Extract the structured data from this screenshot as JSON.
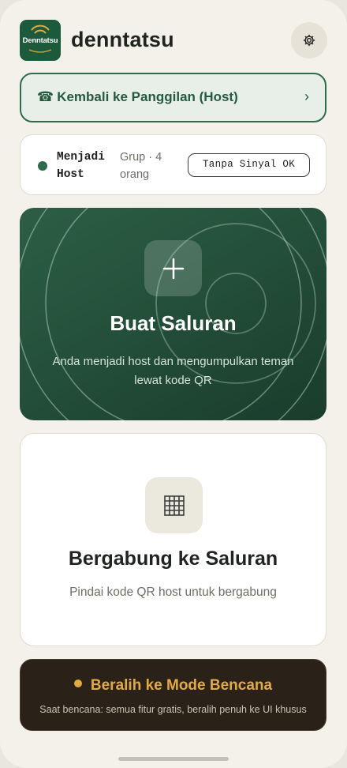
{
  "header": {
    "logo_text": "Denntatsu",
    "app_title": "denntatsu",
    "settings_icon": "gear-icon"
  },
  "call_bar": {
    "icon": "☎",
    "label": "Kembali ke Panggilan (Host)",
    "chevron": "›"
  },
  "status": {
    "role": "Menjadi Host",
    "group": "Grup · 4 orang",
    "signal_badge": "Tanpa Sinyal OK",
    "dot_color": "#2d6b4c"
  },
  "create_channel": {
    "icon": "plus-icon",
    "title": "Buat Saluran",
    "description": "Anda menjadi host dan mengumpulkan teman lewat kode QR"
  },
  "join_channel": {
    "icon": "qr-grid-icon",
    "title": "Bergabung ke Saluran",
    "description": "Pindai kode QR host untuk bergabung"
  },
  "disaster_mode": {
    "title": "Beralih ke Mode Bencana",
    "description": "Saat bencana: semua fitur gratis, beralih penuh ke UI khusus",
    "accent": "#e3ab3b"
  },
  "colors": {
    "brand": "#1c5a3c",
    "background": "#f3f1ea"
  }
}
